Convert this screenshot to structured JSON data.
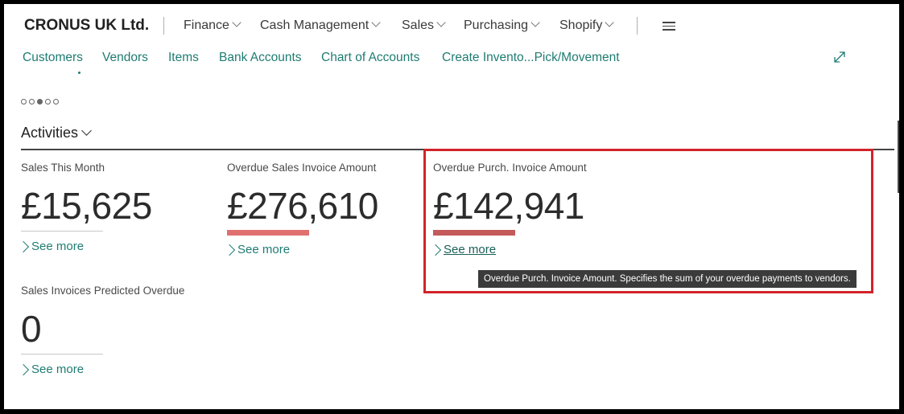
{
  "company": "CRONUS UK Ltd.",
  "menu": [
    {
      "label": "Finance"
    },
    {
      "label": "Cash Management"
    },
    {
      "label": "Sales"
    },
    {
      "label": "Purchasing"
    },
    {
      "label": "Shopify"
    }
  ],
  "actions": [
    "Customers",
    "Vendors",
    "Items",
    "Bank Accounts",
    "Chart of Accounts",
    "Create Invento...Pick/Movement"
  ],
  "carousel": {
    "count": 5,
    "active_index": 2
  },
  "activities": {
    "title": "Activities",
    "tiles": [
      {
        "label": "Sales This Month",
        "value": "£15,625",
        "see_more": "See more"
      },
      {
        "label": "Overdue Sales Invoice Amount",
        "value": "£276,610",
        "see_more": "See more",
        "bar_color": "#e07070"
      },
      {
        "label": "Overdue Purch. Invoice Amount",
        "value": "£142,941",
        "see_more": "See more",
        "bar_color": "#c45a5a"
      },
      {
        "label": "Sales Invoices Predicted Overdue",
        "value": "0",
        "see_more": "See more"
      }
    ]
  },
  "tooltip": "Overdue Purch. Invoice Amount. Specifies the sum of your overdue payments to vendors.",
  "colors": {
    "accent": "#1f7c73",
    "highlight": "#d2232a"
  }
}
